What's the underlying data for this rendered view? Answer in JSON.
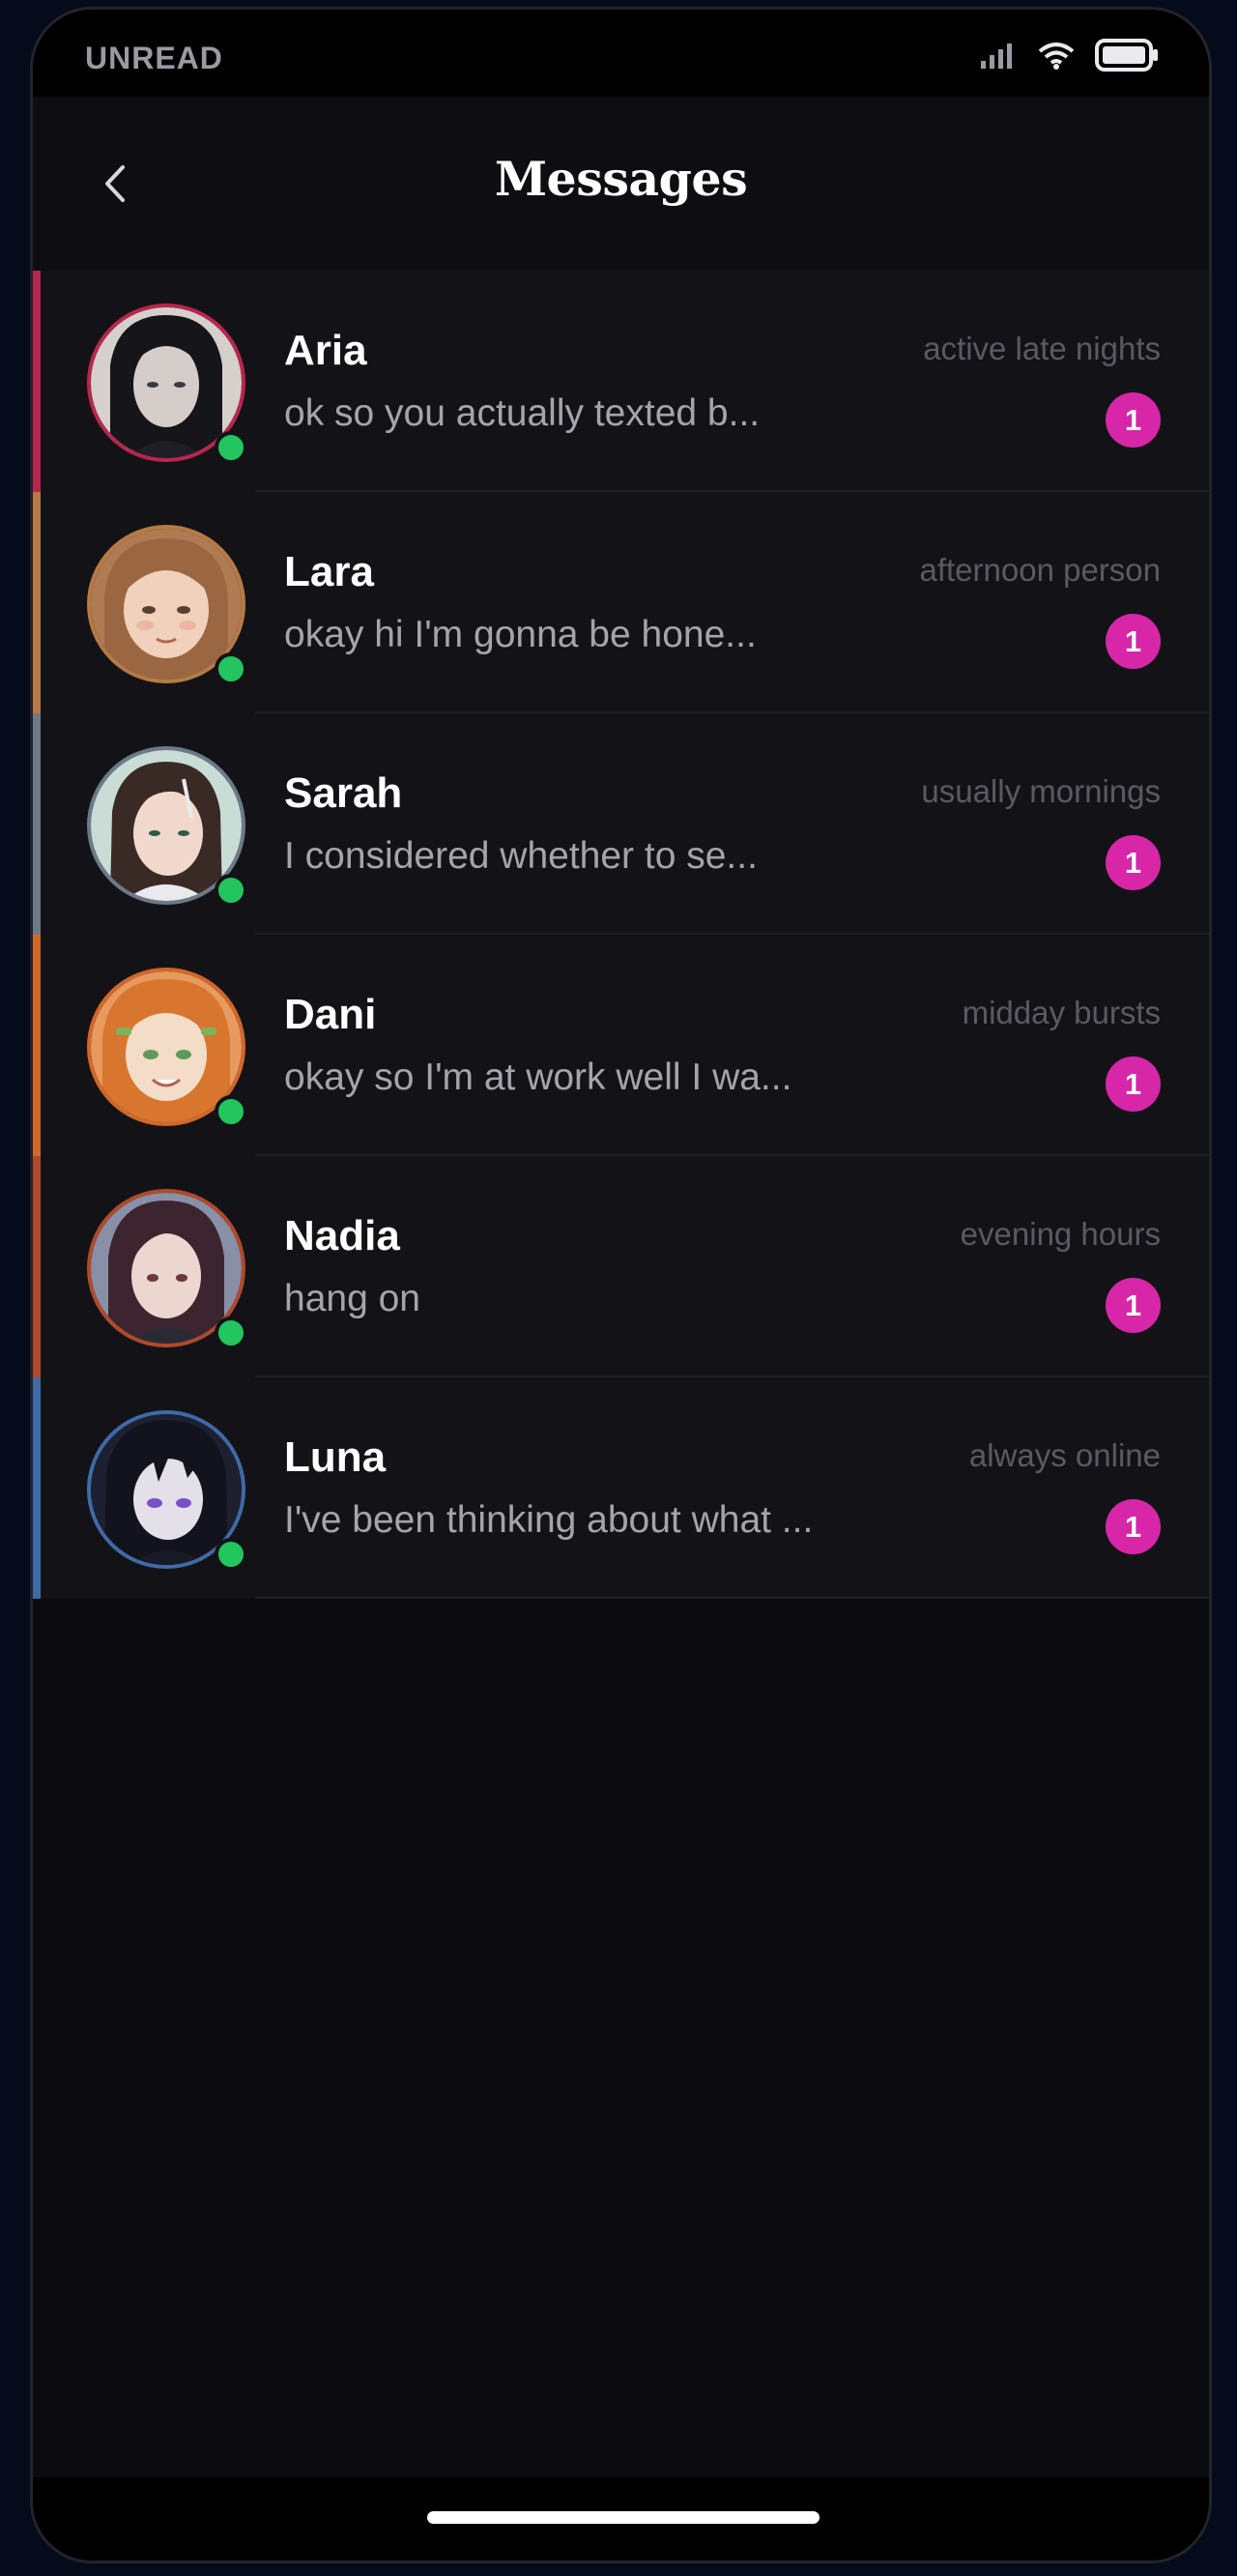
{
  "status_bar": {
    "carrier": "UNREAD",
    "icons": [
      "signal-icon",
      "wifi-icon",
      "battery-icon"
    ]
  },
  "header": {
    "title": "Messages",
    "back_icon": "chevron-left-icon"
  },
  "colors": {
    "badge": "#d726a8",
    "online": "#22c55e"
  },
  "conversations": [
    {
      "name": "Aria",
      "preview": "ok so you actually texted b...",
      "meta": "active late nights",
      "badge": "1",
      "accent": "#b8264e",
      "online": true
    },
    {
      "name": "Lara",
      "preview": "okay hi I'm gonna be hone...",
      "meta": "afternoon person",
      "badge": "1",
      "accent": "#b57a45",
      "online": true
    },
    {
      "name": "Sarah",
      "preview": "I considered whether to se...",
      "meta": "usually mornings",
      "badge": "1",
      "accent": "#6d7a86",
      "online": true
    },
    {
      "name": "Dani",
      "preview": "okay so I'm at work well I wa...",
      "meta": "midday bursts",
      "badge": "1",
      "accent": "#d2672a",
      "online": true
    },
    {
      "name": "Nadia",
      "preview": "hang on",
      "meta": "evening hours",
      "badge": "1",
      "accent": "#b04a2a",
      "online": true
    },
    {
      "name": "Luna",
      "preview": "I've been thinking about what ...",
      "meta": "always online",
      "badge": "1",
      "accent": "#3f6aa6",
      "online": true
    }
  ]
}
